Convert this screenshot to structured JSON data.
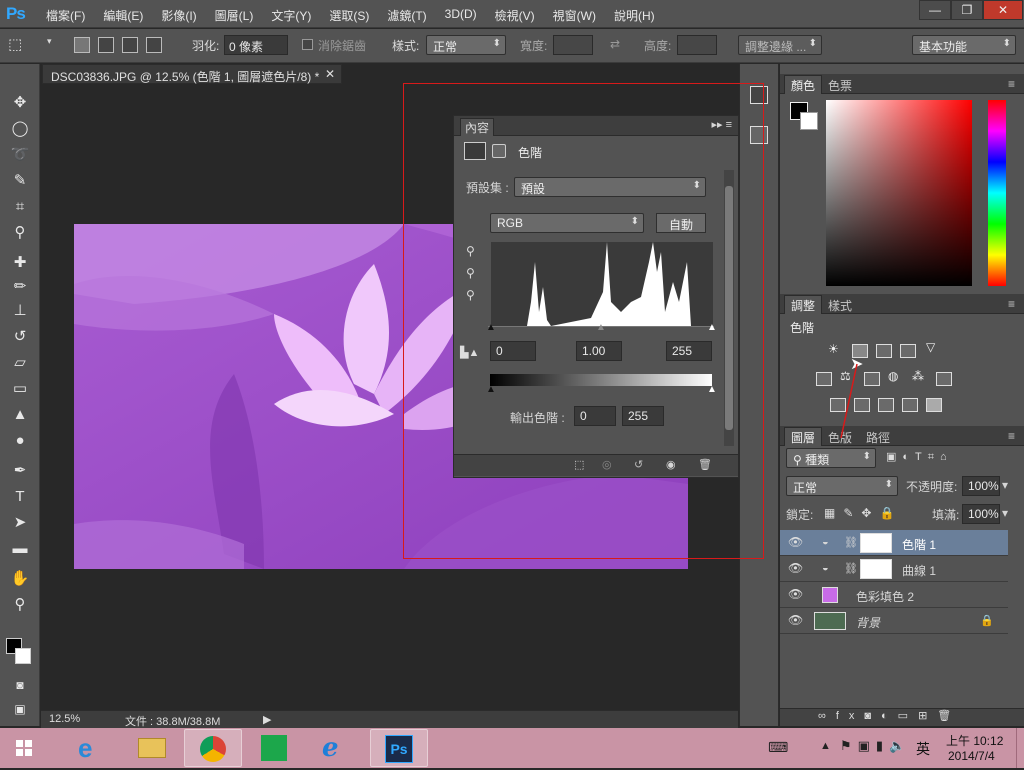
{
  "app": {
    "logo": "Ps"
  },
  "menu": [
    "檔案(F)",
    "編輯(E)",
    "影像(I)",
    "圖層(L)",
    "文字(Y)",
    "選取(S)",
    "濾鏡(T)",
    "3D(D)",
    "檢視(V)",
    "視窗(W)",
    "說明(H)"
  ],
  "window_controls": {
    "minimize": "—",
    "restore": "❐",
    "close": "✕"
  },
  "options": {
    "feather_label": "羽化:",
    "feather_value": "0 像素",
    "antialias_label": "消除鋸齒",
    "style_label": "樣式:",
    "style_value": "正常",
    "width_label": "寬度:",
    "height_label": "高度:",
    "refine_edge": "調整邊緣 ...",
    "workspace": "基本功能"
  },
  "document": {
    "tab_title": "DSC03836.JPG @ 12.5% (色階 1, 圖層遮色片/8) *",
    "zoom": "12.5%",
    "doc_size": "文件 : 38.8M/38.8M"
  },
  "properties": {
    "tab": "內容",
    "adjustment_name": "色階",
    "preset_label": "預設集 :",
    "preset_value": "預設",
    "channel": "RGB",
    "auto_button": "自動",
    "input_black": "0",
    "input_gamma": "1.00",
    "input_white": "255",
    "output_label": "輸出色階 :",
    "output_black": "0",
    "output_white": "255"
  },
  "color_panel": {
    "tabs": [
      "顏色",
      "色票"
    ]
  },
  "adjustments_panel": {
    "tabs": [
      "調整",
      "樣式"
    ],
    "section_label": "色階"
  },
  "layers_panel": {
    "tabs": [
      "圖層",
      "色版",
      "路徑"
    ],
    "filter_kind": "種類",
    "blend_mode": "正常",
    "opacity_label": "不透明度:",
    "opacity_value": "100%",
    "lock_label": "鎖定:",
    "fill_label": "填滿:",
    "fill_value": "100%",
    "layers": [
      {
        "name": "色階 1",
        "selected": true
      },
      {
        "name": "曲線 1",
        "selected": false
      },
      {
        "name": "色彩填色 2",
        "selected": false
      },
      {
        "name": "背景",
        "selected": false
      }
    ]
  },
  "taskbar": {
    "clock_time": "上午 10:12",
    "clock_date": "2014/7/4",
    "ime": "英",
    "apps": [
      "start",
      "internet-explorer",
      "file-explorer",
      "chrome",
      "store",
      "ie-alt",
      "photoshop"
    ]
  },
  "colors": {
    "accent": "#31a8ff",
    "layer_selected": "#6a7f9a",
    "taskbar": "#c994a5",
    "annotation_red": "#d81a1a"
  }
}
